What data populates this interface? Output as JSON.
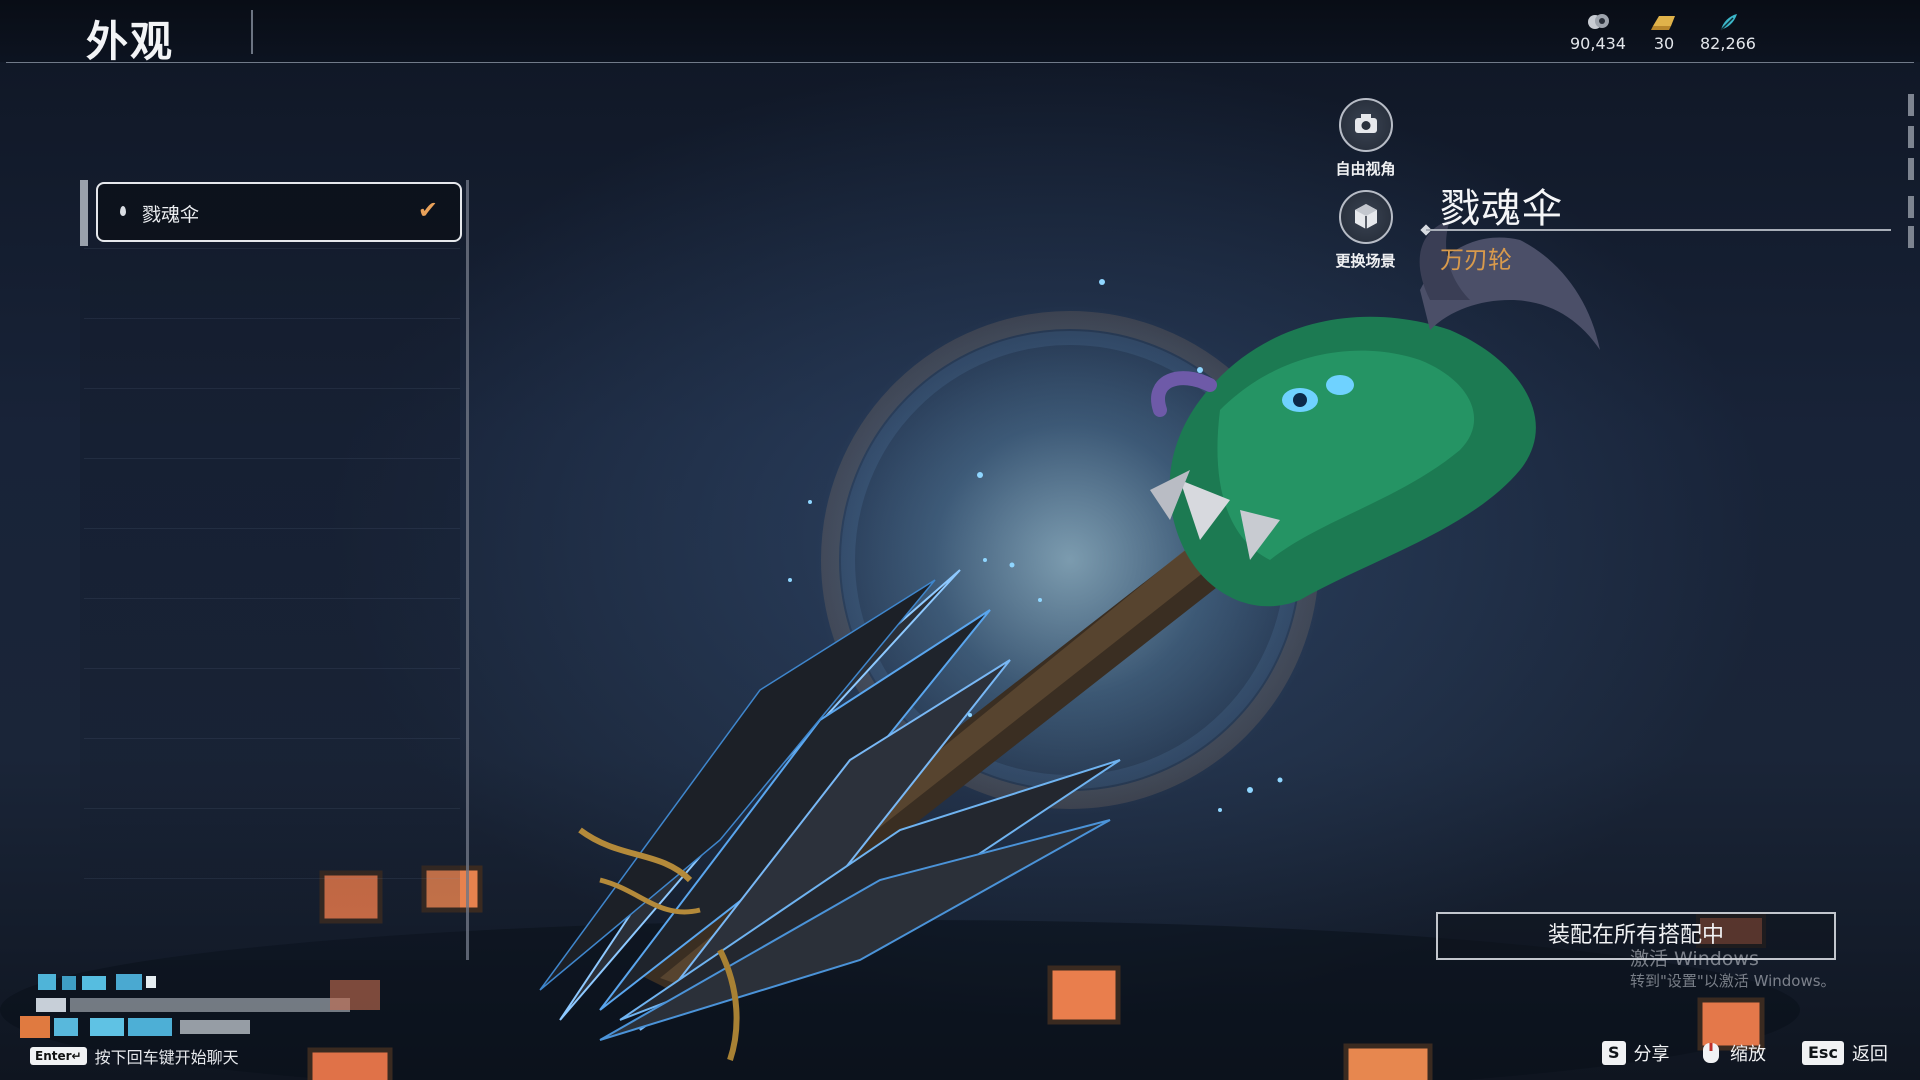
{
  "header": {
    "title": "外观",
    "currencies": [
      {
        "icon": "coin-stack-icon",
        "value": "90,434"
      },
      {
        "icon": "gold-bar-icon",
        "value": "30"
      },
      {
        "icon": "feather-icon",
        "value": "82,266"
      }
    ]
  },
  "skin_list": {
    "items": [
      {
        "label": "戮魂伞",
        "selected": true,
        "equipped": true
      }
    ]
  },
  "side_buttons": {
    "free_camera": "自由视角",
    "change_scene": "更换场景"
  },
  "item": {
    "name": "戮魂伞",
    "type": "万刃轮"
  },
  "equip_button": "装配在所有搭配中",
  "watermark": {
    "line1": "激活 Windows",
    "line2": "转到\"设置\"以激活 Windows。"
  },
  "footer": {
    "chat_key": "Enter↵",
    "chat_hint": "按下回车键开始聊天",
    "share_key": "S",
    "share_label": "分享",
    "zoom_label": "缩放",
    "back_key": "Esc",
    "back_label": "返回"
  },
  "colors": {
    "accent": "#d89a4c",
    "check": "#e8a15a"
  }
}
